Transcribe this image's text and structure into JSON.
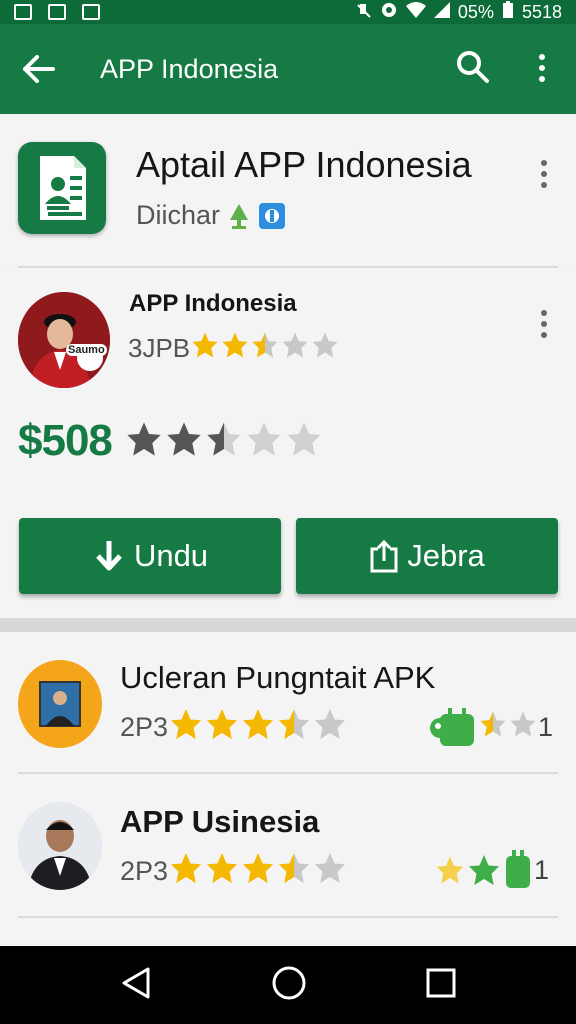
{
  "status_bar": {
    "battery": "05%",
    "time": "5518"
  },
  "app_bar": {
    "title": "APP Indonesia"
  },
  "header": {
    "app_title": "Aptail APP Indonesia",
    "developer": "Diichar"
  },
  "profile": {
    "name": "APP Indonesia",
    "rating_label": "3JPB",
    "rating_stars": 2.5,
    "avatar_caption": "Saumo",
    "price": "$508",
    "price_stars": 2.5
  },
  "actions": {
    "download_label": "Undu",
    "share_label": "Jebra"
  },
  "list": {
    "items": [
      {
        "title": "Ucleran Pungntait APK",
        "rating_label": "2P3",
        "stars": 3.5,
        "badge_value": "1"
      },
      {
        "title": "APP Usinesia",
        "rating_label": "2P3",
        "stars": 3.5,
        "badge_value": "1"
      }
    ]
  },
  "colors": {
    "primary": "#167a44",
    "star_gold": "#f5b800",
    "star_grey": "#c8c8c8",
    "avatar_orange": "#f5a51a",
    "avatar_red": "#b81c1c"
  }
}
